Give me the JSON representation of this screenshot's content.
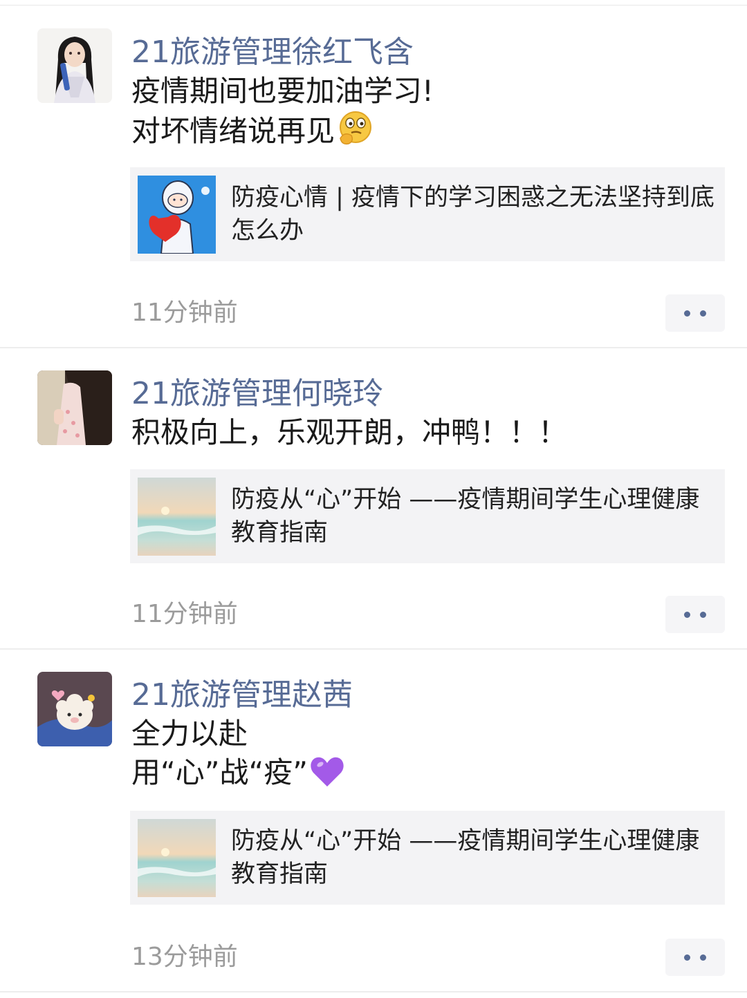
{
  "posts": [
    {
      "author": "21旅游管理徐红飞含",
      "text_lines": [
        "疫情期间也要加油学习!",
        "对坏情绪说再见"
      ],
      "emoji": "thinking-face-emoji",
      "link_title": "防疫心情 | 疫情下的学习困惑之无法坚持到底怎么办",
      "time": "11分钟前"
    },
    {
      "author": "21旅游管理何晓玲",
      "text_lines": [
        "积极向上，乐观开朗，冲鸭！！！"
      ],
      "link_title": "防疫从“心”开始 ——疫情期间学生心理健康教育指南",
      "time": "11分钟前"
    },
    {
      "author": "21旅游管理赵茜",
      "text_lines": [
        "全力以赴",
        "用“心”战“疫”"
      ],
      "emoji": "purple-heart-emoji",
      "link_title": "防疫从“心”开始 ——疫情期间学生心理健康教育指南",
      "time": "13分钟前"
    }
  ],
  "colors": {
    "author": "#576b95",
    "text": "#1a1a1a",
    "time": "#9b9b9b",
    "card_bg": "#f3f3f5",
    "divider": "#ededed"
  },
  "icons": {
    "more": "more-dots-icon"
  }
}
